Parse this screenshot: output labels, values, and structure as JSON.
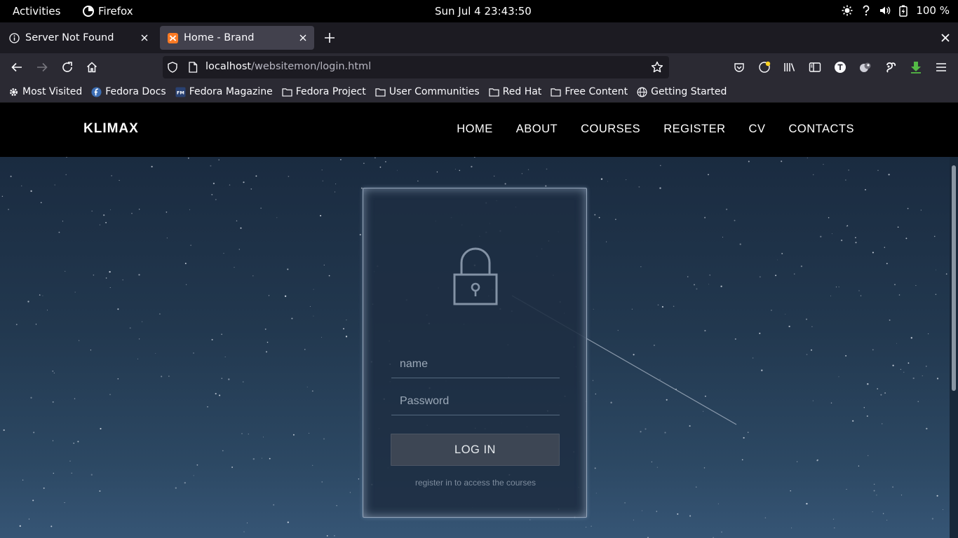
{
  "system": {
    "activities": "Activities",
    "app_name": "Firefox",
    "clock": "Sun Jul 4  23:43:50",
    "battery": "100 %"
  },
  "tabs": [
    {
      "title": "Server Not Found",
      "active": false
    },
    {
      "title": "Home - Brand",
      "active": true
    }
  ],
  "navbar": {
    "url_host": "localhost",
    "url_path": "/websitemon/login.html"
  },
  "bookmarks": [
    {
      "label": "Most Visited",
      "icon": "gear-icon"
    },
    {
      "label": "Fedora Docs",
      "icon": "fedora-icon"
    },
    {
      "label": "Fedora Magazine",
      "icon": "fedora-magazine-icon"
    },
    {
      "label": "Fedora Project",
      "icon": "folder-icon"
    },
    {
      "label": "User Communities",
      "icon": "folder-icon"
    },
    {
      "label": "Red Hat",
      "icon": "folder-icon"
    },
    {
      "label": "Free Content",
      "icon": "folder-icon"
    },
    {
      "label": "Getting Started",
      "icon": "globe-icon"
    }
  ],
  "site": {
    "brand": "KLIMAX",
    "menu": [
      "HOME",
      "ABOUT",
      "COURSES",
      "REGISTER",
      "CV",
      "CONTACTS"
    ]
  },
  "login": {
    "name_placeholder": "name",
    "password_placeholder": "Password",
    "button_label": "LOG IN",
    "hint": "register in to access the courses"
  },
  "colors": {
    "browser_chrome": "#2b2a33",
    "tab_bar": "#1c1b22",
    "hero_top": "#1a2b40",
    "hero_bottom": "#365575"
  }
}
